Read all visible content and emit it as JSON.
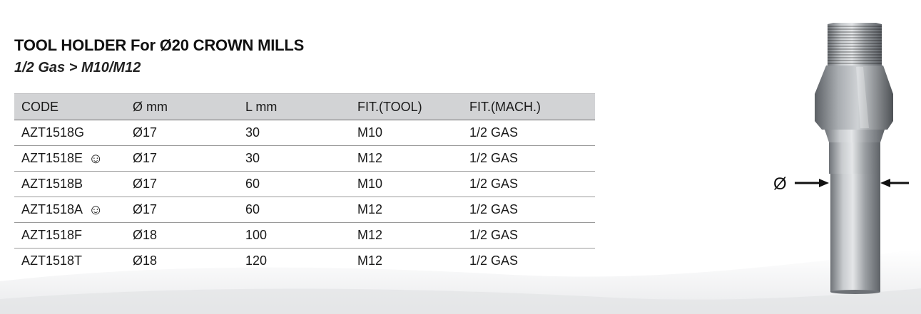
{
  "header": {
    "title": "TOOL HOLDER For Ø20 CROWN MILLS",
    "subtitle": "1/2 Gas > M10/M12"
  },
  "table": {
    "columns": [
      "CODE",
      "Ø mm",
      "L mm",
      "FIT.(TOOL)",
      "FIT.(MACH.)"
    ],
    "rows": [
      {
        "code": "AZT1518G",
        "smile": "",
        "diam": "Ø17",
        "len": "30",
        "tool": "M10",
        "mach": "1/2 GAS"
      },
      {
        "code": "AZT1518E",
        "smile": "☺",
        "diam": "Ø17",
        "len": "30",
        "tool": "M12",
        "mach": "1/2 GAS"
      },
      {
        "code": "AZT1518B",
        "smile": "",
        "diam": "Ø17",
        "len": "60",
        "tool": "M10",
        "mach": "1/2 GAS"
      },
      {
        "code": "AZT1518A",
        "smile": "☺",
        "diam": "Ø17",
        "len": "60",
        "tool": "M12",
        "mach": "1/2 GAS"
      },
      {
        "code": "AZT1518F",
        "smile": "",
        "diam": "Ø18",
        "len": "100",
        "tool": "M12",
        "mach": "1/2 GAS"
      },
      {
        "code": "AZT1518T",
        "smile": "",
        "diam": "Ø18",
        "len": "120",
        "tool": "M12",
        "mach": "1/2 GAS"
      }
    ]
  },
  "figure": {
    "diameter_symbol": "Ø",
    "icon": "tool-holder-illustration"
  },
  "colors": {
    "header_bg": "#d2d3d5",
    "steel_light": "#c8cbce",
    "steel_dark": "#6f7378"
  }
}
